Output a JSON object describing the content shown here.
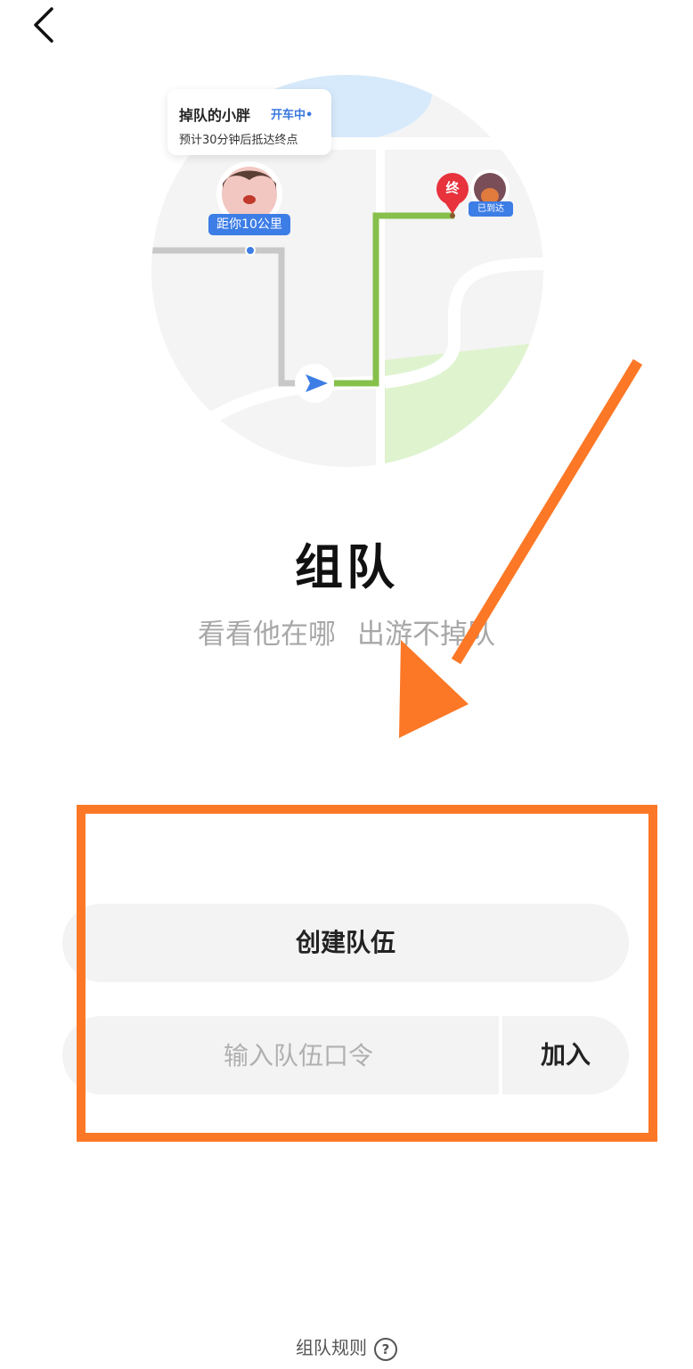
{
  "nav": {
    "back_icon": "chevron-left-icon"
  },
  "map_card": {
    "bubble_name": "掉队的小胖",
    "bubble_status": "开车中•",
    "bubble_eta": "预计30分钟后抵达终点",
    "distance_label": "距你10公里",
    "end_marker": "终",
    "arrived_label": "已到达",
    "route_color": "#86c04b",
    "lagging_route_color": "#c8c8c8"
  },
  "hero": {
    "title": "组队",
    "subtitle_part1": "看看他在哪",
    "subtitle_part2": "出游不掉队"
  },
  "actions": {
    "create_label": "创建队伍",
    "code_placeholder": "输入队伍口令",
    "join_label": "加入"
  },
  "footer": {
    "rules_label": "组队规则",
    "help_icon_glyph": "?"
  },
  "annotation": {
    "color": "#fc7826"
  }
}
